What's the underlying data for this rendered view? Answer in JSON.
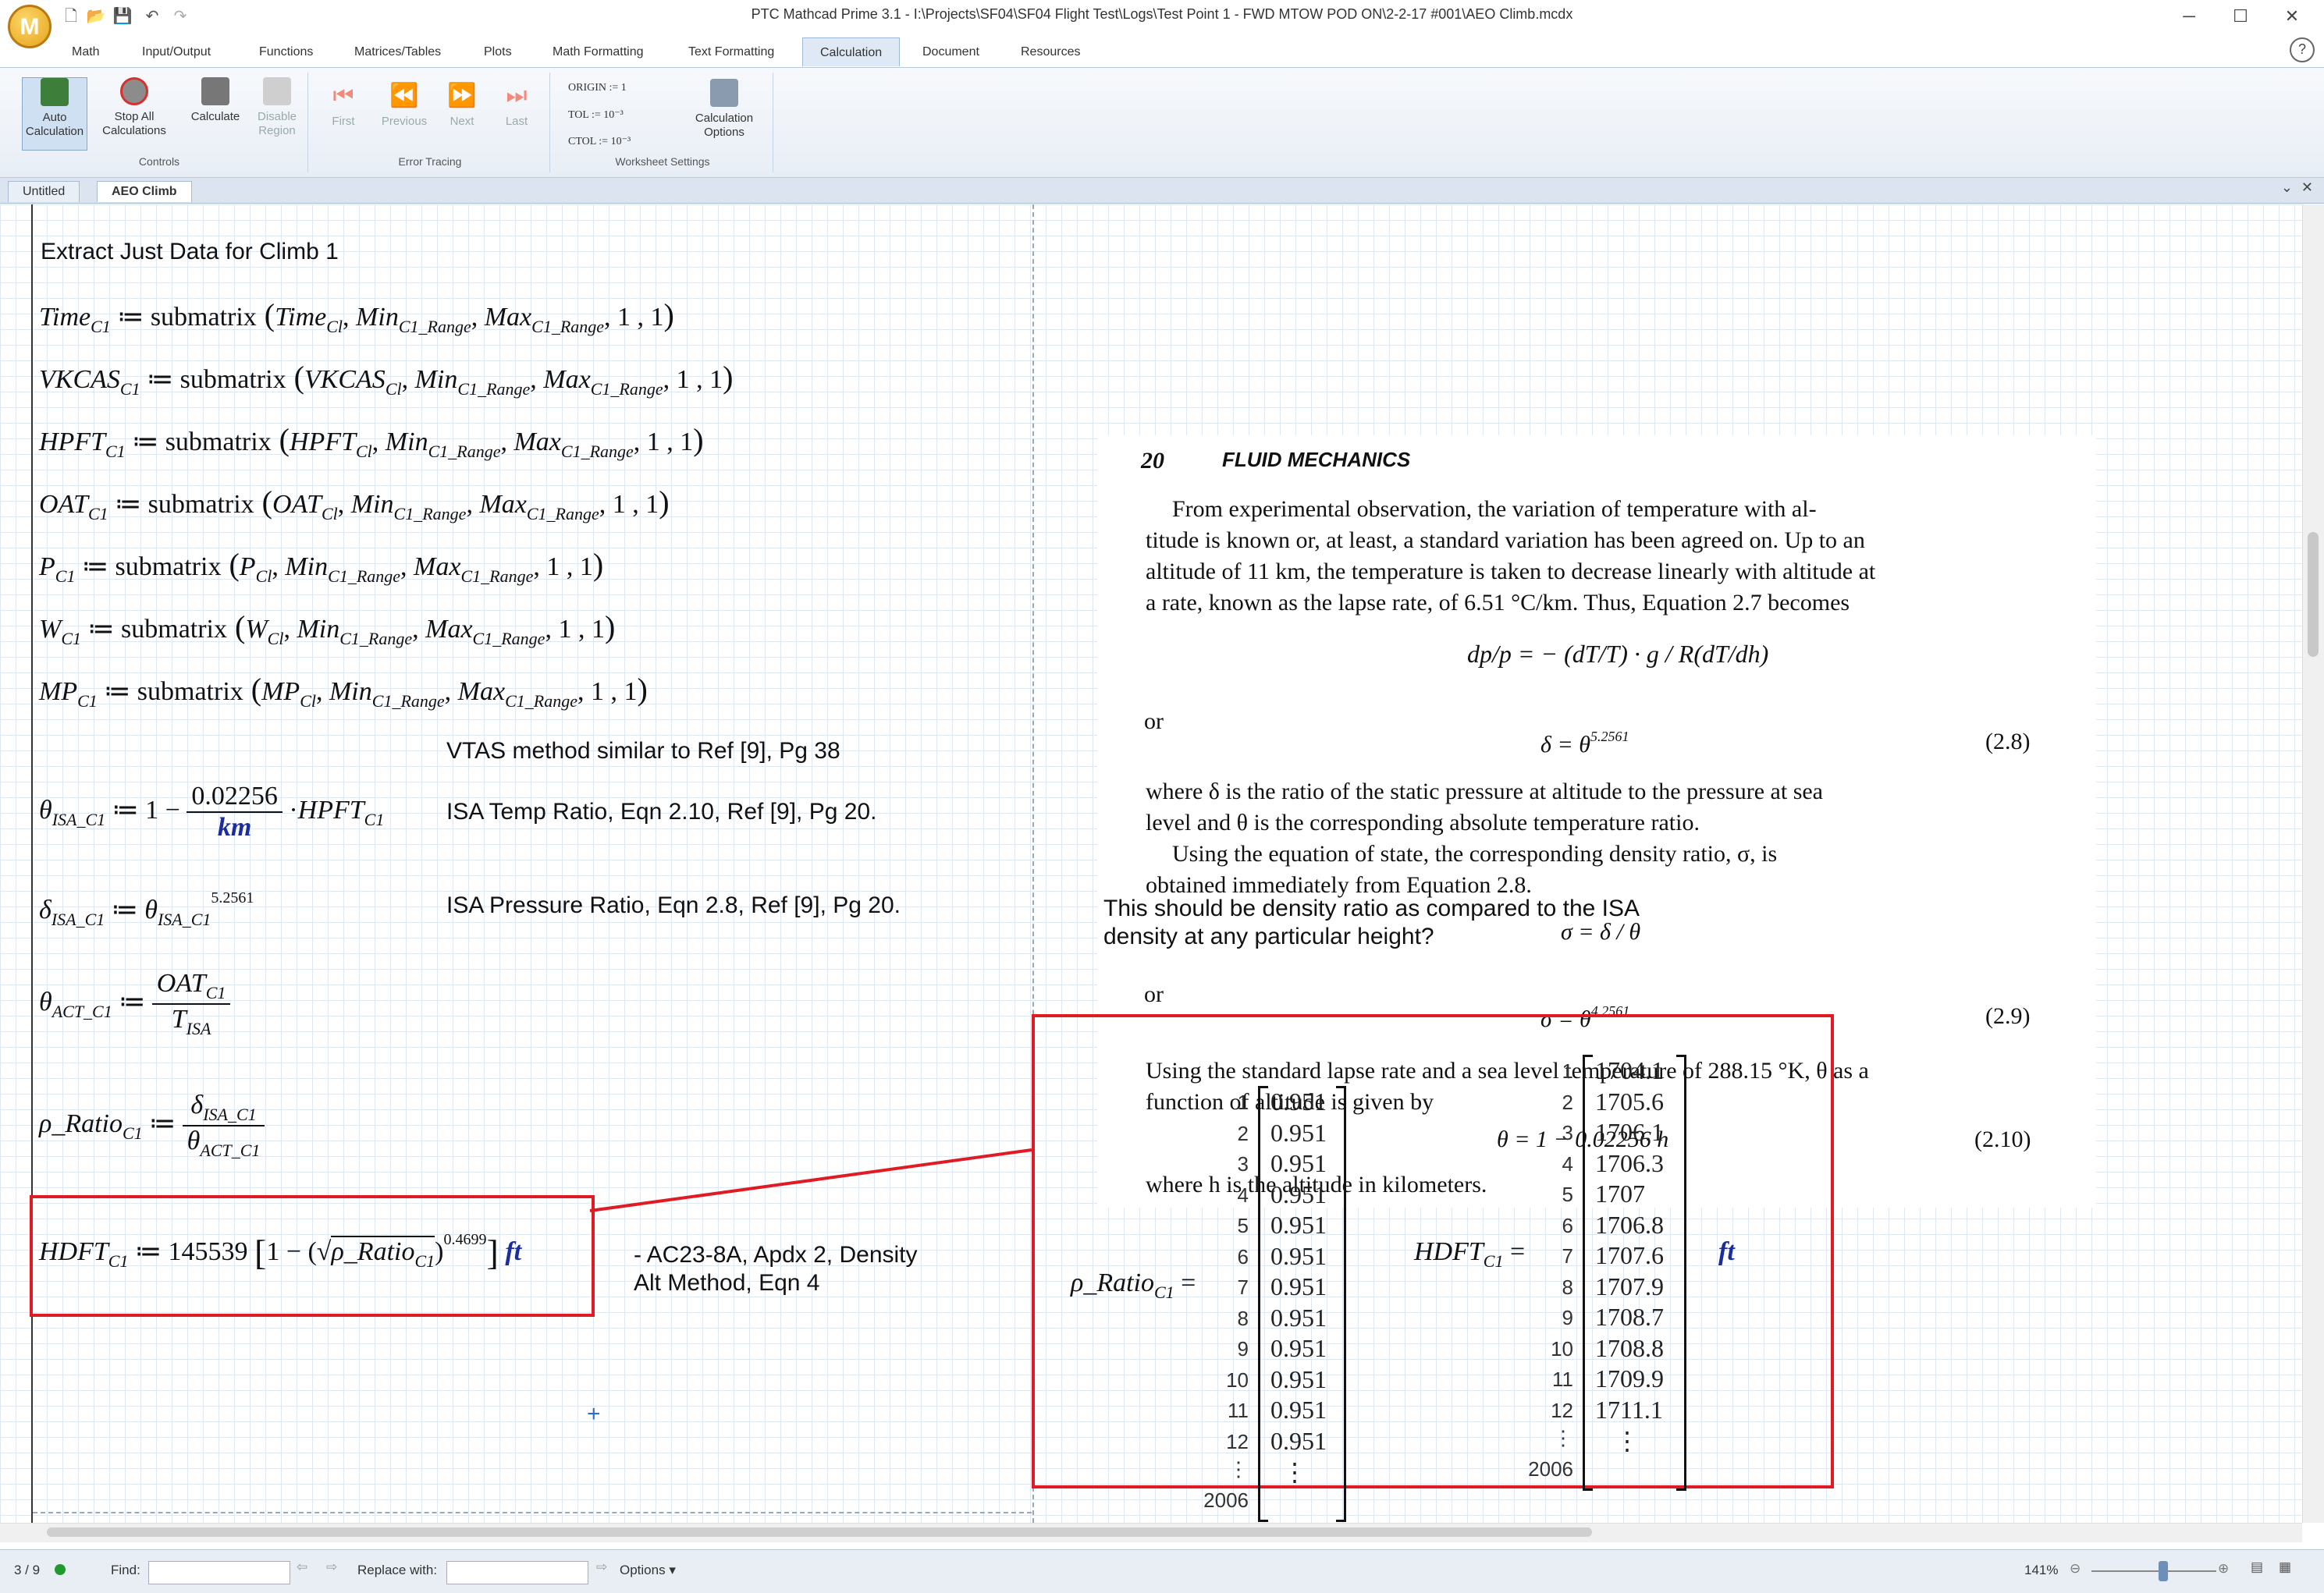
{
  "app": {
    "logo_letter": "M",
    "title": "PTC Mathcad Prime 3.1 - I:\\Projects\\SF04\\SF04 Flight Test\\Logs\\Test Point 1 - FWD MTOW POD ON\\2-2-17 #001\\AEO Climb.mcdx"
  },
  "ribbon_tabs": [
    "Math",
    "Input/Output",
    "Functions",
    "Matrices/Tables",
    "Plots",
    "Math Formatting",
    "Text Formatting",
    "Calculation",
    "Document",
    "Resources"
  ],
  "ribbon": {
    "controls": {
      "label": "Controls",
      "auto_calc": "Auto\nCalculation",
      "auto_calc_l1": "Auto",
      "auto_calc_l2": "Calculation",
      "stop_l1": "Stop All",
      "stop_l2": "Calculations",
      "calculate": "Calculate",
      "disable_l1": "Disable",
      "disable_l2": "Region"
    },
    "error_tracing": {
      "label": "Error Tracing",
      "first": "First",
      "previous": "Previous",
      "next": "Next",
      "last": "Last"
    },
    "worksheet_settings": {
      "label": "Worksheet Settings",
      "origin": "ORIGIN := 1",
      "tol": "TOL := 10⁻³",
      "ctol": "CTOL := 10⁻³",
      "calc_options_l1": "Calculation",
      "calc_options_l2": "Options"
    }
  },
  "doc_tabs": [
    "Untitled",
    "AEO Climb"
  ],
  "worksheet": {
    "heading": "Extract Just Data for Climb 1",
    "assignments": [
      {
        "lhs": "Time",
        "arg": "Time"
      },
      {
        "lhs": "VKCAS",
        "arg": "VKCAS"
      },
      {
        "lhs": "HPFT",
        "arg": "HPFT"
      },
      {
        "lhs": "OAT",
        "arg": "OAT"
      },
      {
        "lhs": "P",
        "arg": "P"
      },
      {
        "lhs": "W",
        "arg": "W"
      },
      {
        "lhs": "MP",
        "arg": "MP"
      }
    ],
    "sub_c1": "C1",
    "sub_cl": "Cl",
    "func": "submatrix",
    "min": "Min",
    "max": "Max",
    "range_sub": "C1_Range",
    "ones": "1 , 1",
    "vtas_note": "VTAS method similar to Ref [9], Pg 38",
    "theta_isa_note": "ISA Temp Ratio, Eqn 2.10, Ref [9], Pg 20.",
    "delta_isa_note": "ISA Pressure Ratio, Eqn 2.8, Ref [9], Pg 20.",
    "theta_coef": "0.02256",
    "theta_unit": "km",
    "delta_exp": "5.2561",
    "hdft_coef": "145539",
    "hdft_exp": "0.4699",
    "hdft_unit": "ft",
    "hdft_note_l1": "- AC23-8A, Apdx 2, Density",
    "hdft_note_l2": "Alt Method, Eqn 4",
    "density_note_l1": "This should be density ratio as compared to the ISA",
    "density_note_l2": "density at any particular height?"
  },
  "book": {
    "page_number": "20",
    "running_head": "FLUID MECHANICS",
    "para1": [
      "From experimental observation, the variation of temperature with al-",
      "titude is known or, at least, a standard variation has been agreed on. Up to an",
      "altitude of 11 km, the temperature is taken to decrease linearly with altitude at",
      "a rate, known as the lapse rate, of 6.51 °C/km. Thus, Equation 2.7 becomes"
    ],
    "or": "or",
    "eq28": "δ = θ",
    "eq28_exp": "5.2561",
    "eq28_num": "(2.8)",
    "para2": [
      "where δ is the ratio of the static pressure at altitude to the pressure at sea",
      "level and θ is the corresponding absolute temperature ratio.",
      "Using the equation of state, the corresponding density ratio, σ, is",
      "obtained immediately from Equation 2.8."
    ],
    "eq29": "σ = θ",
    "eq29_exp": "4.2561",
    "eq29_num": "(2.9)",
    "para3": [
      "Using the standard lapse rate and a sea level temperature of 288.15 °K, θ as a",
      "function of altitude is given by"
    ],
    "eq210": "θ = 1 − 0.02256 h",
    "eq210_num": "(2.10)",
    "last_line": "where h is the altitude in kilometers."
  },
  "results": {
    "rho_label": "ρ_Ratio",
    "rho_values": [
      "0.951",
      "0.951",
      "0.951",
      "0.951",
      "0.951",
      "0.951",
      "0.951",
      "0.951",
      "0.951",
      "0.951",
      "0.951",
      "0.951"
    ],
    "rho_last_index": "2006",
    "hdft_label": "HDFT",
    "hdft_values": [
      "1704.1",
      "1705.6",
      "1706.1",
      "1706.3",
      "1707",
      "1706.8",
      "1707.6",
      "1707.9",
      "1708.7",
      "1708.8",
      "1709.9",
      "1711.1"
    ],
    "hdft_last_index": "2006",
    "unit": "ft",
    "ellipsis": "⋮"
  },
  "status": {
    "page": "3 / 9",
    "find_label": "Find:",
    "find_value": "",
    "replace_label": "Replace with:",
    "replace_value": "",
    "options_label": "Options",
    "zoom": "141%"
  },
  "colors": {
    "red_box": "#e01b24",
    "unit_blue": "#1b2d9c"
  }
}
